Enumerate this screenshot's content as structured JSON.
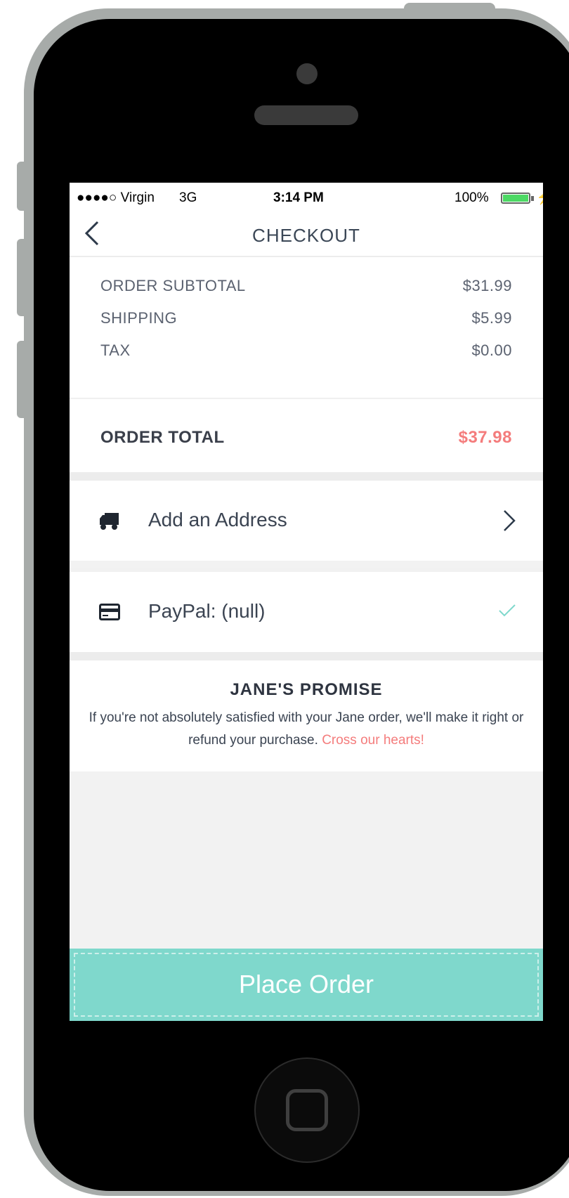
{
  "status_bar": {
    "carrier": "●●●●○ Virgin",
    "network": "3G",
    "time": "3:14 PM",
    "battery_percent": "100%",
    "battery_level": 1.0
  },
  "nav": {
    "title": "CHECKOUT"
  },
  "summary": {
    "rows": [
      {
        "label": "ORDER SUBTOTAL",
        "value": "$31.99"
      },
      {
        "label": "SHIPPING",
        "value": "$5.99"
      },
      {
        "label": "TAX",
        "value": "$0.00"
      }
    ],
    "total_label": "ORDER TOTAL",
    "total_value": "$37.98"
  },
  "address": {
    "label": "Add an Address",
    "icon": "truck-icon"
  },
  "payment": {
    "label": "PayPal: (null)",
    "icon": "credit-card-icon",
    "checked": true
  },
  "promise": {
    "title": "JANE'S PROMISE",
    "text": "If you're not absolutely satisfied with your Jane order, we'll make it right or refund your purchase.",
    "highlight": "Cross our hearts!"
  },
  "place_order": {
    "label": "Place Order"
  },
  "colors": {
    "accent": "#7fd8cc",
    "price_highlight": "#f47c7c",
    "check": "#7fd8cc"
  }
}
